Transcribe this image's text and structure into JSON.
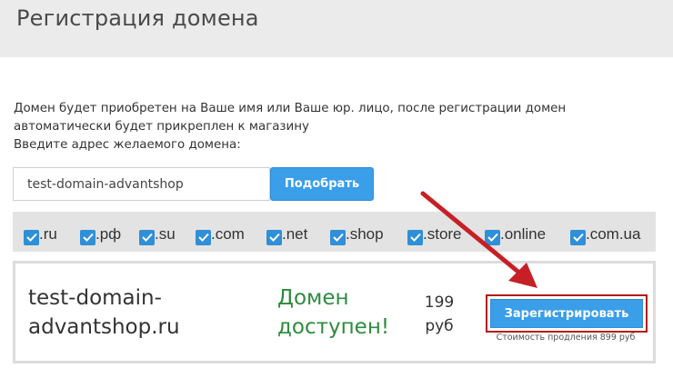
{
  "header": {
    "title": "Регистрация домена"
  },
  "description": {
    "line1": "Домен будет приобретен на Ваше имя или Ваше юр. лицо, после регистрации домен",
    "line2": "автоматически будет прикреплен к магазину",
    "line3": "Введите адрес желаемого домена:"
  },
  "search": {
    "value": "test-domain-advantshop",
    "button_label": "Подобрать"
  },
  "zones": [
    {
      "label": ".ru",
      "checked": true
    },
    {
      "label": ".рф",
      "checked": true
    },
    {
      "label": ".su",
      "checked": true
    },
    {
      "label": ".com",
      "checked": true
    },
    {
      "label": ".net",
      "checked": true
    },
    {
      "label": ".shop",
      "checked": true
    },
    {
      "label": ".store",
      "checked": true
    },
    {
      "label": ".online",
      "checked": true
    },
    {
      "label": ".com.ua",
      "checked": true
    }
  ],
  "result": {
    "domain_line1": "test-domain-",
    "domain_line2": "advantshop.ru",
    "status_line1": "Домен",
    "status_line2": "доступен!",
    "price_value": "199",
    "price_unit": "руб",
    "register_label": "Зарегистрировать",
    "renewal_note": "Стоимость продления 899 руб"
  },
  "colors": {
    "accent": "#3a9ee8",
    "available": "#2e8b3e",
    "highlight": "#b31b1b"
  }
}
